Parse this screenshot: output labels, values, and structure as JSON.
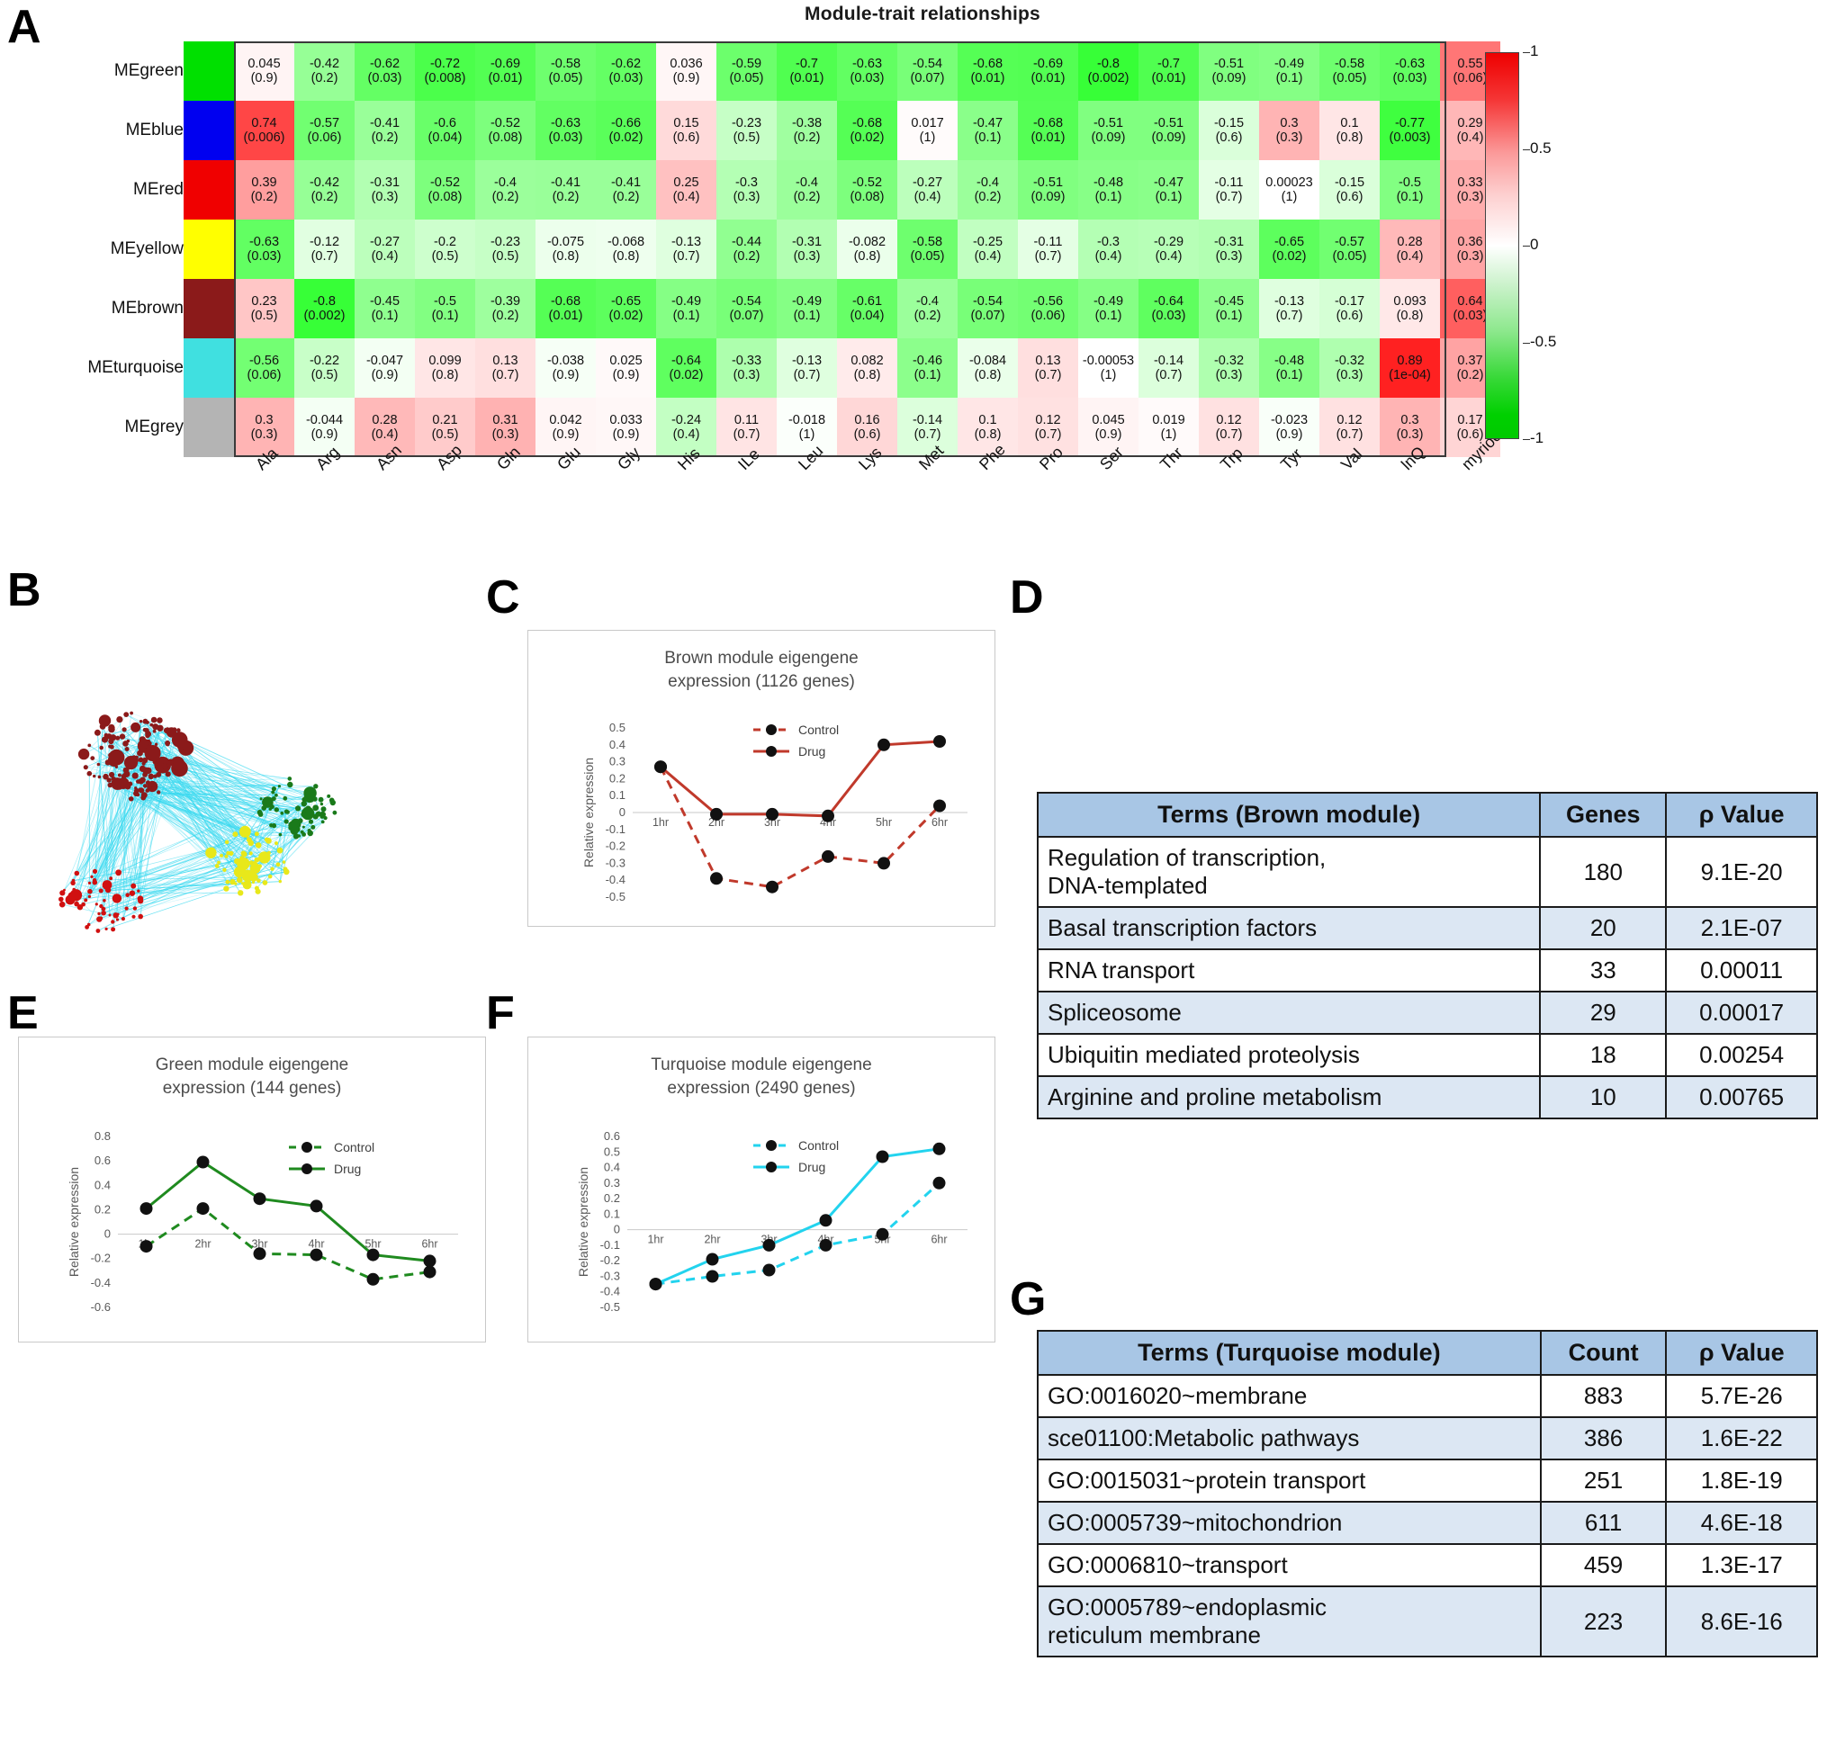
{
  "panels": {
    "A": "A",
    "B": "B",
    "C": "C",
    "D": "D",
    "E": "E",
    "F": "F",
    "G": "G"
  },
  "heatmap": {
    "title": "Module-trait relationships",
    "row_labels": [
      "MEgreen",
      "MEblue",
      "MEred",
      "MEyellow",
      "MEbrown",
      "MEturquoise",
      "MEgrey"
    ],
    "row_colors": [
      "#00e000",
      "#0000f0",
      "#f00000",
      "#ffff00",
      "#8b1a1a",
      "#40e0e0",
      "#b4b4b4"
    ],
    "col_labels": [
      "Ala",
      "Arg",
      "Asn",
      "Asp",
      "Gln",
      "Glu",
      "Gly",
      "His",
      "ILe",
      "Leu",
      "Lys",
      "Met",
      "Phe",
      "Pro",
      "Ser",
      "Thr",
      "Trp",
      "Tyr",
      "Val",
      "lnQ",
      "myriocin"
    ],
    "colorbar": {
      "ticks": [
        "1",
        "0.5",
        "0",
        "-0.5",
        "-1"
      ],
      "max": 1,
      "min": -1
    },
    "cells": [
      [
        {
          "v": "0.045",
          "p": "(0.9)",
          "c": 0.045
        },
        {
          "v": "-0.42",
          "p": "(0.2)",
          "c": -0.42
        },
        {
          "v": "-0.62",
          "p": "(0.03)",
          "c": -0.62
        },
        {
          "v": "-0.72",
          "p": "(0.008)",
          "c": -0.72
        },
        {
          "v": "-0.69",
          "p": "(0.01)",
          "c": -0.69
        },
        {
          "v": "-0.58",
          "p": "(0.05)",
          "c": -0.58
        },
        {
          "v": "-0.62",
          "p": "(0.03)",
          "c": -0.62
        },
        {
          "v": "0.036",
          "p": "(0.9)",
          "c": 0.036
        },
        {
          "v": "-0.59",
          "p": "(0.05)",
          "c": -0.59
        },
        {
          "v": "-0.7",
          "p": "(0.01)",
          "c": -0.7
        },
        {
          "v": "-0.63",
          "p": "(0.03)",
          "c": -0.63
        },
        {
          "v": "-0.54",
          "p": "(0.07)",
          "c": -0.54
        },
        {
          "v": "-0.68",
          "p": "(0.01)",
          "c": -0.68
        },
        {
          "v": "-0.69",
          "p": "(0.01)",
          "c": -0.69
        },
        {
          "v": "-0.8",
          "p": "(0.002)",
          "c": -0.8
        },
        {
          "v": "-0.7",
          "p": "(0.01)",
          "c": -0.7
        },
        {
          "v": "-0.51",
          "p": "(0.09)",
          "c": -0.51
        },
        {
          "v": "-0.49",
          "p": "(0.1)",
          "c": -0.49
        },
        {
          "v": "-0.58",
          "p": "(0.05)",
          "c": -0.58
        },
        {
          "v": "-0.63",
          "p": "(0.03)",
          "c": -0.63
        },
        {
          "v": "0.55",
          "p": "(0.06)",
          "c": 0.55
        }
      ],
      [
        {
          "v": "0.74",
          "p": "(0.006)",
          "c": 0.74
        },
        {
          "v": "-0.57",
          "p": "(0.06)",
          "c": -0.57
        },
        {
          "v": "-0.41",
          "p": "(0.2)",
          "c": -0.41
        },
        {
          "v": "-0.6",
          "p": "(0.04)",
          "c": -0.6
        },
        {
          "v": "-0.52",
          "p": "(0.08)",
          "c": -0.52
        },
        {
          "v": "-0.63",
          "p": "(0.03)",
          "c": -0.63
        },
        {
          "v": "-0.66",
          "p": "(0.02)",
          "c": -0.66
        },
        {
          "v": "0.15",
          "p": "(0.6)",
          "c": 0.15
        },
        {
          "v": "-0.23",
          "p": "(0.5)",
          "c": -0.23
        },
        {
          "v": "-0.38",
          "p": "(0.2)",
          "c": -0.38
        },
        {
          "v": "-0.68",
          "p": "(0.02)",
          "c": -0.68
        },
        {
          "v": "0.017",
          "p": "(1)",
          "c": 0.017
        },
        {
          "v": "-0.47",
          "p": "(0.1)",
          "c": -0.47
        },
        {
          "v": "-0.68",
          "p": "(0.01)",
          "c": -0.68
        },
        {
          "v": "-0.51",
          "p": "(0.09)",
          "c": -0.51
        },
        {
          "v": "-0.51",
          "p": "(0.09)",
          "c": -0.51
        },
        {
          "v": "-0.15",
          "p": "(0.6)",
          "c": -0.15
        },
        {
          "v": "0.3",
          "p": "(0.3)",
          "c": 0.3
        },
        {
          "v": "0.1",
          "p": "(0.8)",
          "c": 0.1
        },
        {
          "v": "-0.77",
          "p": "(0.003)",
          "c": -0.77
        },
        {
          "v": "0.29",
          "p": "(0.4)",
          "c": 0.29
        }
      ],
      [
        {
          "v": "0.39",
          "p": "(0.2)",
          "c": 0.39
        },
        {
          "v": "-0.42",
          "p": "(0.2)",
          "c": -0.42
        },
        {
          "v": "-0.31",
          "p": "(0.3)",
          "c": -0.31
        },
        {
          "v": "-0.52",
          "p": "(0.08)",
          "c": -0.52
        },
        {
          "v": "-0.4",
          "p": "(0.2)",
          "c": -0.4
        },
        {
          "v": "-0.41",
          "p": "(0.2)",
          "c": -0.41
        },
        {
          "v": "-0.41",
          "p": "(0.2)",
          "c": -0.41
        },
        {
          "v": "0.25",
          "p": "(0.4)",
          "c": 0.25
        },
        {
          "v": "-0.3",
          "p": "(0.3)",
          "c": -0.3
        },
        {
          "v": "-0.4",
          "p": "(0.2)",
          "c": -0.4
        },
        {
          "v": "-0.52",
          "p": "(0.08)",
          "c": -0.52
        },
        {
          "v": "-0.27",
          "p": "(0.4)",
          "c": -0.27
        },
        {
          "v": "-0.4",
          "p": "(0.2)",
          "c": -0.4
        },
        {
          "v": "-0.51",
          "p": "(0.09)",
          "c": -0.51
        },
        {
          "v": "-0.48",
          "p": "(0.1)",
          "c": -0.48
        },
        {
          "v": "-0.47",
          "p": "(0.1)",
          "c": -0.47
        },
        {
          "v": "-0.11",
          "p": "(0.7)",
          "c": -0.11
        },
        {
          "v": "0.00023",
          "p": "(1)",
          "c": 0.00023
        },
        {
          "v": "-0.15",
          "p": "(0.6)",
          "c": -0.15
        },
        {
          "v": "-0.5",
          "p": "(0.1)",
          "c": -0.5
        },
        {
          "v": "0.33",
          "p": "(0.3)",
          "c": 0.33
        }
      ],
      [
        {
          "v": "-0.63",
          "p": "(0.03)",
          "c": -0.63
        },
        {
          "v": "-0.12",
          "p": "(0.7)",
          "c": -0.12
        },
        {
          "v": "-0.27",
          "p": "(0.4)",
          "c": -0.27
        },
        {
          "v": "-0.2",
          "p": "(0.5)",
          "c": -0.2
        },
        {
          "v": "-0.23",
          "p": "(0.5)",
          "c": -0.23
        },
        {
          "v": "-0.075",
          "p": "(0.8)",
          "c": -0.075
        },
        {
          "v": "-0.068",
          "p": "(0.8)",
          "c": -0.068
        },
        {
          "v": "-0.13",
          "p": "(0.7)",
          "c": -0.13
        },
        {
          "v": "-0.44",
          "p": "(0.2)",
          "c": -0.44
        },
        {
          "v": "-0.31",
          "p": "(0.3)",
          "c": -0.31
        },
        {
          "v": "-0.082",
          "p": "(0.8)",
          "c": -0.082
        },
        {
          "v": "-0.58",
          "p": "(0.05)",
          "c": -0.58
        },
        {
          "v": "-0.25",
          "p": "(0.4)",
          "c": -0.25
        },
        {
          "v": "-0.11",
          "p": "(0.7)",
          "c": -0.11
        },
        {
          "v": "-0.3",
          "p": "(0.4)",
          "c": -0.3
        },
        {
          "v": "-0.29",
          "p": "(0.4)",
          "c": -0.29
        },
        {
          "v": "-0.31",
          "p": "(0.3)",
          "c": -0.31
        },
        {
          "v": "-0.65",
          "p": "(0.02)",
          "c": -0.65
        },
        {
          "v": "-0.57",
          "p": "(0.05)",
          "c": -0.57
        },
        {
          "v": "0.28",
          "p": "(0.4)",
          "c": 0.28
        },
        {
          "v": "0.36",
          "p": "(0.3)",
          "c": 0.36
        }
      ],
      [
        {
          "v": "0.23",
          "p": "(0.5)",
          "c": 0.23
        },
        {
          "v": "-0.8",
          "p": "(0.002)",
          "c": -0.8
        },
        {
          "v": "-0.45",
          "p": "(0.1)",
          "c": -0.45
        },
        {
          "v": "-0.5",
          "p": "(0.1)",
          "c": -0.5
        },
        {
          "v": "-0.39",
          "p": "(0.2)",
          "c": -0.39
        },
        {
          "v": "-0.68",
          "p": "(0.01)",
          "c": -0.68
        },
        {
          "v": "-0.65",
          "p": "(0.02)",
          "c": -0.65
        },
        {
          "v": "-0.49",
          "p": "(0.1)",
          "c": -0.49
        },
        {
          "v": "-0.54",
          "p": "(0.07)",
          "c": -0.54
        },
        {
          "v": "-0.49",
          "p": "(0.1)",
          "c": -0.49
        },
        {
          "v": "-0.61",
          "p": "(0.04)",
          "c": -0.61
        },
        {
          "v": "-0.4",
          "p": "(0.2)",
          "c": -0.4
        },
        {
          "v": "-0.54",
          "p": "(0.07)",
          "c": -0.54
        },
        {
          "v": "-0.56",
          "p": "(0.06)",
          "c": -0.56
        },
        {
          "v": "-0.49",
          "p": "(0.1)",
          "c": -0.49
        },
        {
          "v": "-0.64",
          "p": "(0.03)",
          "c": -0.64
        },
        {
          "v": "-0.45",
          "p": "(0.1)",
          "c": -0.45
        },
        {
          "v": "-0.13",
          "p": "(0.7)",
          "c": -0.13
        },
        {
          "v": "-0.17",
          "p": "(0.6)",
          "c": -0.17
        },
        {
          "v": "0.093",
          "p": "(0.8)",
          "c": 0.093
        },
        {
          "v": "0.64",
          "p": "(0.03)",
          "c": 0.64
        }
      ],
      [
        {
          "v": "-0.56",
          "p": "(0.06)",
          "c": -0.56
        },
        {
          "v": "-0.22",
          "p": "(0.5)",
          "c": -0.22
        },
        {
          "v": "-0.047",
          "p": "(0.9)",
          "c": -0.047
        },
        {
          "v": "0.099",
          "p": "(0.8)",
          "c": 0.099
        },
        {
          "v": "0.13",
          "p": "(0.7)",
          "c": 0.13
        },
        {
          "v": "-0.038",
          "p": "(0.9)",
          "c": -0.038
        },
        {
          "v": "0.025",
          "p": "(0.9)",
          "c": 0.025
        },
        {
          "v": "-0.64",
          "p": "(0.02)",
          "c": -0.64
        },
        {
          "v": "-0.33",
          "p": "(0.3)",
          "c": -0.33
        },
        {
          "v": "-0.13",
          "p": "(0.7)",
          "c": -0.13
        },
        {
          "v": "0.082",
          "p": "(0.8)",
          "c": 0.082
        },
        {
          "v": "-0.46",
          "p": "(0.1)",
          "c": -0.46
        },
        {
          "v": "-0.084",
          "p": "(0.8)",
          "c": -0.084
        },
        {
          "v": "0.13",
          "p": "(0.7)",
          "c": 0.13
        },
        {
          "v": "-0.00053",
          "p": "(1)",
          "c": -0.00053
        },
        {
          "v": "-0.14",
          "p": "(0.7)",
          "c": -0.14
        },
        {
          "v": "-0.32",
          "p": "(0.3)",
          "c": -0.32
        },
        {
          "v": "-0.48",
          "p": "(0.1)",
          "c": -0.48
        },
        {
          "v": "-0.32",
          "p": "(0.3)",
          "c": -0.32
        },
        {
          "v": "0.89",
          "p": "(1e-04)",
          "c": 0.89
        },
        {
          "v": "0.37",
          "p": "(0.2)",
          "c": 0.37
        }
      ],
      [
        {
          "v": "0.3",
          "p": "(0.3)",
          "c": 0.3
        },
        {
          "v": "-0.044",
          "p": "(0.9)",
          "c": -0.044
        },
        {
          "v": "0.28",
          "p": "(0.4)",
          "c": 0.28
        },
        {
          "v": "0.21",
          "p": "(0.5)",
          "c": 0.21
        },
        {
          "v": "0.31",
          "p": "(0.3)",
          "c": 0.31
        },
        {
          "v": "0.042",
          "p": "(0.9)",
          "c": 0.042
        },
        {
          "v": "0.033",
          "p": "(0.9)",
          "c": 0.033
        },
        {
          "v": "-0.24",
          "p": "(0.4)",
          "c": -0.24
        },
        {
          "v": "0.11",
          "p": "(0.7)",
          "c": 0.11
        },
        {
          "v": "-0.018",
          "p": "(1)",
          "c": -0.018
        },
        {
          "v": "0.16",
          "p": "(0.6)",
          "c": 0.16
        },
        {
          "v": "-0.14",
          "p": "(0.7)",
          "c": -0.14
        },
        {
          "v": "0.1",
          "p": "(0.8)",
          "c": 0.1
        },
        {
          "v": "0.12",
          "p": "(0.7)",
          "c": 0.12
        },
        {
          "v": "0.045",
          "p": "(0.9)",
          "c": 0.045
        },
        {
          "v": "0.019",
          "p": "(1)",
          "c": 0.019
        },
        {
          "v": "0.12",
          "p": "(0.7)",
          "c": 0.12
        },
        {
          "v": "-0.023",
          "p": "(0.9)",
          "c": -0.023
        },
        {
          "v": "0.12",
          "p": "(0.7)",
          "c": 0.12
        },
        {
          "v": "0.3",
          "p": "(0.3)",
          "c": 0.3
        },
        {
          "v": "0.17",
          "p": "(0.6)",
          "c": 0.17
        }
      ]
    ]
  },
  "network": {
    "node_colors": [
      "#8b1a1a",
      "#1a7a1a",
      "#e8e81a",
      "#d01010"
    ],
    "edge_color": "#34d8ef"
  },
  "chart_data": [
    {
      "panel": "C",
      "type": "line",
      "title": "Brown module eigengene expression (1126 genes)",
      "title_line1": "Brown module eigengene",
      "title_line2": "expression (1126 genes)",
      "xlabel": "",
      "ylabel": "Relative expression",
      "categories": [
        "1hr",
        "2hr",
        "3hr",
        "4hr",
        "5hr",
        "6hr"
      ],
      "ylim": [
        -0.5,
        0.5
      ],
      "yticks": [
        "0.5",
        "0.4",
        "0.3",
        "0.2",
        "0.1",
        "0",
        "-0.1",
        "-0.2",
        "-0.3",
        "-0.4",
        "-0.5"
      ],
      "color": "#c0392b",
      "series": [
        {
          "name": "Control",
          "style": "dashed",
          "values": [
            0.27,
            -0.39,
            -0.44,
            -0.26,
            -0.3,
            0.04
          ]
        },
        {
          "name": "Drug",
          "style": "solid",
          "values": [
            0.27,
            -0.01,
            -0.01,
            -0.02,
            0.4,
            0.42
          ]
        }
      ],
      "legend": [
        "Control",
        "Drug"
      ]
    },
    {
      "panel": "E",
      "type": "line",
      "title": "Green module eigengene expression (144 genes)",
      "title_line1": "Green module eigengene",
      "title_line2": "expression (144 genes)",
      "xlabel": "",
      "ylabel": "Relative expression",
      "categories": [
        "1hr",
        "2hr",
        "3hr",
        "4hr",
        "5hr",
        "6hr"
      ],
      "ylim": [
        -0.6,
        0.8
      ],
      "yticks": [
        "0.8",
        "0.6",
        "0.4",
        "0.2",
        "0",
        "-0.2",
        "-0.4",
        "-0.6"
      ],
      "color": "#1f8a1f",
      "series": [
        {
          "name": "Control",
          "style": "dashed",
          "values": [
            -0.1,
            0.21,
            -0.16,
            -0.17,
            -0.37,
            -0.31
          ]
        },
        {
          "name": "Drug",
          "style": "solid",
          "values": [
            0.21,
            0.59,
            0.29,
            0.23,
            -0.17,
            -0.22
          ]
        }
      ],
      "legend": [
        "Control",
        "Drug"
      ]
    },
    {
      "panel": "F",
      "type": "line",
      "title": "Turquoise module eigengene expression (2490 genes)",
      "title_line1": "Turquoise module eigengene",
      "title_line2": "expression  (2490 genes)",
      "xlabel": "",
      "ylabel": "Relative expression",
      "categories": [
        "1hr",
        "2hr",
        "3hr",
        "4hr",
        "5hr",
        "6hr"
      ],
      "ylim": [
        -0.5,
        0.6
      ],
      "yticks": [
        "0.6",
        "0.5",
        "0.4",
        "0.3",
        "0.2",
        "0.1",
        "0",
        "-0.1",
        "-0.2",
        "-0.3",
        "-0.4",
        "-0.5"
      ],
      "color": "#22d3ee",
      "series": [
        {
          "name": "Control",
          "style": "dashed",
          "values": [
            -0.35,
            -0.3,
            -0.26,
            -0.1,
            -0.03,
            0.3
          ]
        },
        {
          "name": "Drug",
          "style": "solid",
          "values": [
            -0.35,
            -0.19,
            -0.1,
            0.06,
            0.47,
            0.52
          ]
        }
      ],
      "legend": [
        "Control",
        "Drug"
      ]
    }
  ],
  "tableD": {
    "headers": [
      "Terms (Brown module)",
      "Genes",
      "ρ Value"
    ],
    "rows": [
      {
        "term": "Regulation of transcription, DNA-templated",
        "term_l1": "Regulation of transcription,",
        "term_l2": "DNA-templated",
        "count": "180",
        "p": "9.1E-20"
      },
      {
        "term": "Basal transcription factors",
        "count": "20",
        "p": "2.1E-07"
      },
      {
        "term": "RNA transport",
        "count": "33",
        "p": "0.00011"
      },
      {
        "term": "Spliceosome",
        "count": "29",
        "p": "0.00017"
      },
      {
        "term": "Ubiquitin mediated proteolysis",
        "count": "18",
        "p": "0.00254"
      },
      {
        "term": "Arginine and proline metabolism",
        "count": "10",
        "p": "0.00765"
      }
    ]
  },
  "tableG": {
    "headers": [
      "Terms (Turquoise module)",
      "Count",
      "ρ Value"
    ],
    "rows": [
      {
        "term": "GO:0016020~membrane",
        "count": "883",
        "p": "5.7E-26"
      },
      {
        "term": "sce01100:Metabolic pathways",
        "count": "386",
        "p": "1.6E-22"
      },
      {
        "term": "GO:0015031~protein  transport",
        "count": "251",
        "p": "1.8E-19"
      },
      {
        "term": "GO:0005739~mitochondrion",
        "count": "611",
        "p": "4.6E-18"
      },
      {
        "term": "GO:0006810~transport",
        "count": "459",
        "p": "1.3E-17"
      },
      {
        "term": "GO:0005789~endoplasmic reticulum membrane",
        "term_l1": "GO:0005789~endoplasmic",
        "term_l2": "reticulum membrane",
        "count": "223",
        "p": "8.6E-16"
      }
    ]
  }
}
